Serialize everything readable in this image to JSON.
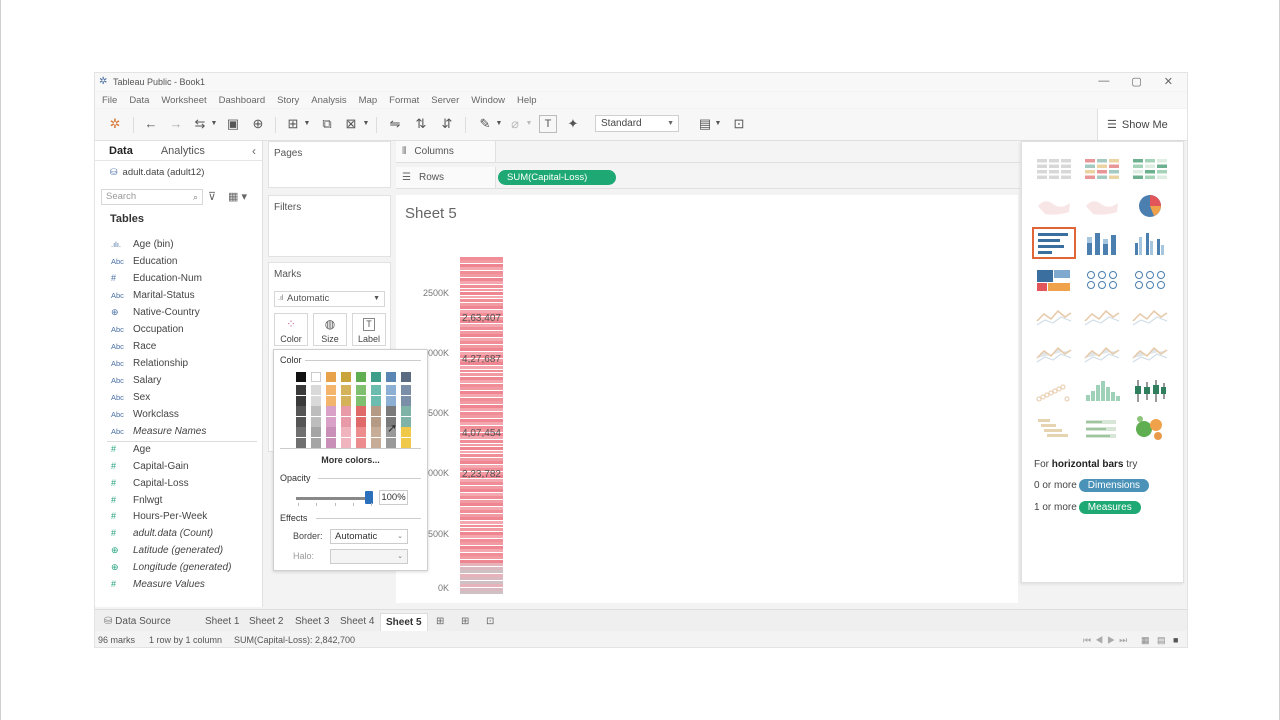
{
  "window": {
    "title": "Tableau Public - Book1",
    "controls": [
      "—",
      "▢",
      "✕"
    ]
  },
  "menu": [
    "File",
    "Data",
    "Worksheet",
    "Dashboard",
    "Story",
    "Analysis",
    "Map",
    "Format",
    "Server",
    "Window",
    "Help"
  ],
  "toolbar": {
    "view_size": "Standard",
    "show_me_label": "Show Me"
  },
  "data_pane": {
    "tabs": [
      "Data",
      "Analytics"
    ],
    "source": "adult.data (adult12)",
    "search_placeholder": "Search",
    "tables_heading": "Tables",
    "dimensions": [
      {
        "type": "bin",
        "name": "Age (bin)"
      },
      {
        "type": "Abc",
        "name": "Education"
      },
      {
        "type": "#",
        "name": "Education-Num"
      },
      {
        "type": "Abc",
        "name": "Marital-Status"
      },
      {
        "type": "geo",
        "name": "Native-Country"
      },
      {
        "type": "Abc",
        "name": "Occupation"
      },
      {
        "type": "Abc",
        "name": "Race"
      },
      {
        "type": "Abc",
        "name": "Relationship"
      },
      {
        "type": "Abc",
        "name": "Salary"
      },
      {
        "type": "Abc",
        "name": "Sex"
      },
      {
        "type": "Abc",
        "name": "Workclass"
      },
      {
        "type": "Abc",
        "name": "Measure Names",
        "italic": true
      }
    ],
    "measures": [
      {
        "type": "#",
        "name": "Age"
      },
      {
        "type": "#",
        "name": "Capital-Gain"
      },
      {
        "type": "#",
        "name": "Capital-Loss"
      },
      {
        "type": "#",
        "name": "Fnlwgt"
      },
      {
        "type": "#",
        "name": "Hours-Per-Week"
      },
      {
        "type": "#",
        "name": "adult.data (Count)",
        "italic": true
      },
      {
        "type": "geo",
        "name": "Latitude (generated)",
        "italic": true
      },
      {
        "type": "geo",
        "name": "Longitude (generated)",
        "italic": true
      },
      {
        "type": "#",
        "name": "Measure Values",
        "italic": true
      }
    ]
  },
  "cards": {
    "pages": "Pages",
    "filters": "Filters",
    "marks": "Marks",
    "mark_type": "Automatic",
    "buttons": [
      "Color",
      "Size",
      "Label"
    ]
  },
  "shelves": {
    "columns": "Columns",
    "rows": "Rows",
    "rows_pill": "SUM(Capital-Loss)"
  },
  "sheet": {
    "title": "Sheet 5",
    "y_ticks": [
      "2500K",
      "000K",
      "500K",
      "000K",
      "500K",
      "0K"
    ],
    "data_labels": [
      "2,63,407",
      "4,27,687",
      "4,07,454",
      "2,23,782"
    ]
  },
  "chart_data": {
    "type": "bar",
    "categories": [
      ""
    ],
    "values": [
      2842700
    ],
    "ylabel": "Capital-Loss",
    "ylim": [
      0,
      2900000
    ],
    "segment_labels": [
      263407,
      427687,
      407454,
      223782
    ]
  },
  "color_popup": {
    "color_heading": "Color",
    "more_colors": "More colors...",
    "opacity_heading": "Opacity",
    "opacity_value": "100%",
    "opacity": 1.0,
    "effects_heading": "Effects",
    "border_label": "Border:",
    "border_value": "Automatic",
    "halo_label": "Halo:",
    "palette_columns": [
      [
        "#111111",
        "#3a3a3a",
        "#555555",
        "#6f6f6f"
      ],
      [
        "#ffffff",
        "#d9d9d9",
        "#bdbdbd",
        "#a5a5a5"
      ],
      [
        "#e8a34a",
        "#f2b56b",
        "#d9a0c8",
        "#c98fb8"
      ],
      [
        "#c9a43a",
        "#d4b25a",
        "#e89aa8",
        "#f0b4be"
      ],
      [
        "#5fae52",
        "#7fc070",
        "#e06a6a",
        "#ec8c8c"
      ],
      [
        "#3f9e8a",
        "#6bbcae",
        "#b59a86",
        "#c7ad98"
      ],
      [
        "#5b86b3",
        "#8bb0d4",
        "#7a7a7a",
        "#999999"
      ],
      [
        "#5a6a80",
        "#7b8ea8",
        "#7fb3a8",
        "#f0c84a"
      ]
    ]
  },
  "show_me": {
    "hint_prefix": "For",
    "hint_chart": "horizontal bars",
    "hint_suffix": "try",
    "dim_prefix": "0 or more",
    "dim_label": "Dimensions",
    "meas_prefix": "1 or more",
    "meas_label": "Measures"
  },
  "sheet_tabs": [
    "Data Source",
    "Sheet 1",
    "Sheet 2",
    "Sheet 3",
    "Sheet 4",
    "Sheet 5"
  ],
  "status": {
    "marks": "96 marks",
    "layout": "1 row by 1 column",
    "sum": "SUM(Capital-Loss): 2,842,700"
  },
  "colors": {
    "bar": "#f08d96",
    "pill_measure": "#1ea974",
    "pill_dimension": "#4a92b8",
    "selected_border": "#e06637"
  }
}
